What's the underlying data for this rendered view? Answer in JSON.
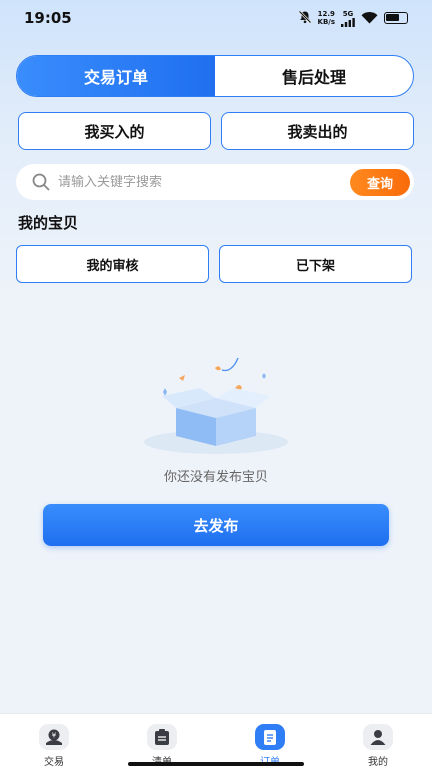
{
  "status_bar": {
    "time": "19:05",
    "net_speed_value": "12.9",
    "net_speed_unit": "KB/s",
    "network": "5G",
    "icons": [
      "bell-off-icon",
      "signal-icon",
      "wifi-icon",
      "battery-icon"
    ]
  },
  "top_tabs": [
    {
      "label": "交易订单",
      "active": true
    },
    {
      "label": "售后处理",
      "active": false
    }
  ],
  "order_type": {
    "bought": "我买入的",
    "sold": "我卖出的"
  },
  "search": {
    "placeholder": "请输入关键字搜索",
    "button": "查询"
  },
  "my_items": {
    "title": "我的宝贝",
    "review": "我的审核",
    "offline": "已下架"
  },
  "empty_state": {
    "message": "你还没有发布宝贝",
    "illustration": "empty-box-icon"
  },
  "publish_button": "去发布",
  "tabbar": [
    {
      "label": "交易",
      "icon": "trade-icon",
      "active": false
    },
    {
      "label": "清单",
      "icon": "list-icon",
      "active": false
    },
    {
      "label": "订单",
      "icon": "order-icon",
      "active": true
    },
    {
      "label": "我的",
      "icon": "profile-icon",
      "active": false
    }
  ],
  "colors": {
    "primary": "#2f7ef5",
    "accent_orange": "#f96b0a",
    "background": "#eef3f9"
  }
}
